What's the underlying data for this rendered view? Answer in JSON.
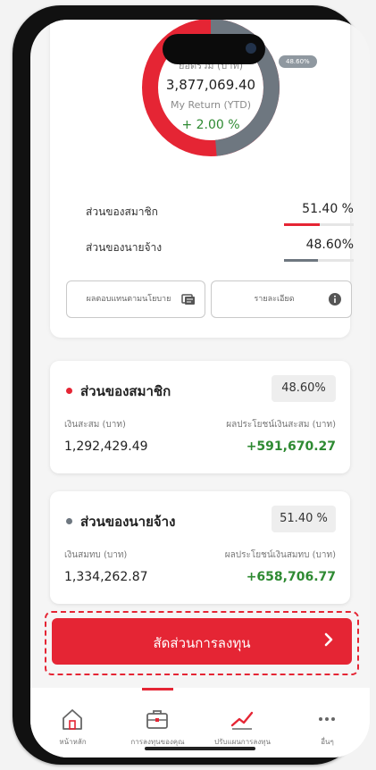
{
  "colors": {
    "accent": "#e52534",
    "employer": "#6e7780",
    "positive": "#2e8a32"
  },
  "summary": {
    "total_label": "ยอดรวม (บาท)",
    "total_value": "3,877,069.40",
    "return_label": "My Return (YTD)",
    "return_value": "+ 2.00 %",
    "employer_pct_tag": "48.60%",
    "member_share_label": "ส่วนของสมาชิก",
    "member_share_pct": "51.40 %",
    "member_share_fraction": 0.514,
    "employer_share_label": "ส่วนของนายจ้าง",
    "employer_share_pct": "48.60%",
    "employer_share_fraction": 0.486,
    "button_investment_plan": "ผลตอบแทนตามนโยบาย",
    "button_details": "รายละเอียด"
  },
  "member_card": {
    "title": "ส่วนของสมาชิก",
    "pct": "48.60%",
    "left_label": "เงินสะสม (บาท)",
    "left_value": "1,292,429.49",
    "right_label": "ผลประโยชน์เงินสะสม (บาท)",
    "right_value": "+591,670.27"
  },
  "employer_card": {
    "title": "ส่วนของนายจ้าง",
    "pct": "51.40 %",
    "left_label": "เงินสมทบ (บาท)",
    "left_value": "1,334,262.87",
    "right_label": "ผลประโยชน์เงินสมทบ (บาท)",
    "right_value": "+658,706.77"
  },
  "cta": {
    "label": "สัดส่วนการลงทุน"
  },
  "tabs": [
    {
      "label": "หน้าหลัก",
      "icon": "home-icon"
    },
    {
      "label": "การลงทุนของคุณ",
      "icon": "briefcase-icon",
      "active": true
    },
    {
      "label": "ปรับแผนการลงทุน",
      "icon": "trend-icon"
    },
    {
      "label": "อื่นๆ",
      "icon": "more-icon"
    }
  ]
}
